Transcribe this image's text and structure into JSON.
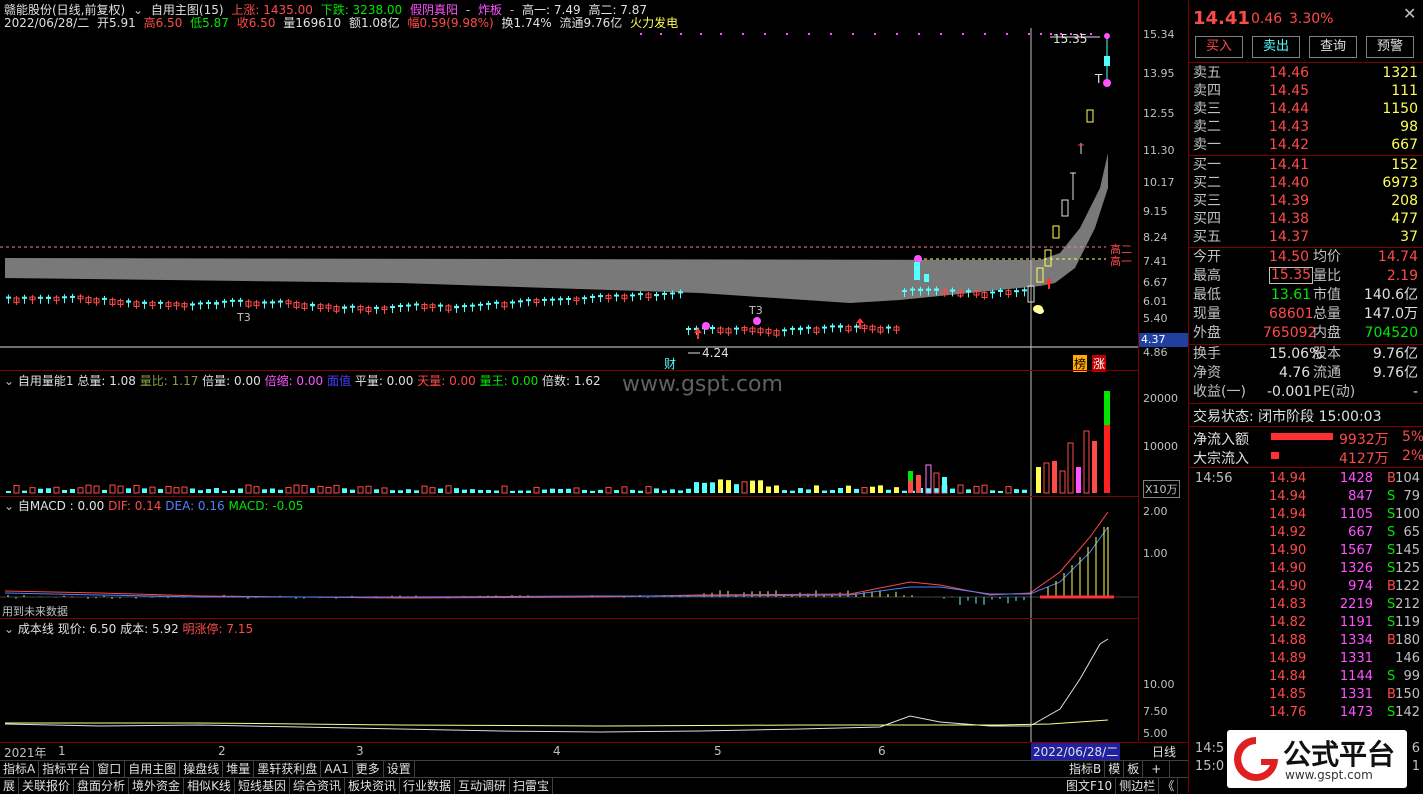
{
  "header": {
    "stock_name": "赣能股份(日线,前复权)",
    "indicator_name": "自用主图(15)",
    "up": "上涨: 1435.00",
    "down": "下跌: 3238.00",
    "yinyang": "假阴真阳",
    "zhaban": "炸板",
    "gao1": "高一: 7.49",
    "gao2": "高二: 7.87",
    "date": "2022/06/28/二",
    "open": "开5.91",
    "high": "高6.50",
    "low": "低5.87",
    "close": "收6.50",
    "volume": "量169610",
    "amount": "额1.08亿",
    "amplitude": "幅0.59(9.98%)",
    "turnover": "换1.74%",
    "float_cap": "流通9.76亿",
    "sector": "火力发电"
  },
  "main_pane": {
    "annot_high": "15.35",
    "annot_low": "4.24",
    "t3_1": "T3",
    "t3_2": "T3",
    "t_label": "T",
    "cai": "财",
    "bang": "榜",
    "zhang": "涨",
    "gao_er": "高二",
    "gao_yi": "高一",
    "current_tag": "4.37"
  },
  "right_axis": {
    "main_ticks": [
      "15.34",
      "13.95",
      "12.55",
      "11.30",
      "10.17",
      "9.15",
      "8.24",
      "7.41",
      "6.67",
      "6.01",
      "5.40",
      "4.86"
    ],
    "vol_ticks": [
      "20000",
      "10000",
      "X10万"
    ],
    "macd_ticks": [
      "2.00",
      "1.00"
    ],
    "cost_ticks": [
      "10.00",
      "7.50",
      "5.00"
    ]
  },
  "vol_pane": {
    "name": "自用量能1",
    "total": "总量: 1.08",
    "ratio": "量比: 1.17",
    "bei": "倍量: 0.00",
    "beisuo": "倍缩: 0.00",
    "mian": "面值",
    "ping": "平量: 0.00",
    "tian": "天量: 0.00",
    "wang": "量王: 0.00",
    "beishu": "倍数: 1.62",
    "watermark": "www.gspt.com"
  },
  "macd_pane": {
    "name": "自MACD : 0.00",
    "dif": "DIF: 0.14",
    "dea": "DEA: 0.16",
    "macd": "MACD: -0.05",
    "future_note": "用到未来数据"
  },
  "cost_pane": {
    "name": "成本线",
    "now": "现价: 6.50",
    "cost": "成本: 5.92",
    "zhangting": "明涨停: 7.15"
  },
  "timebar": {
    "year": "2021年",
    "m1": "1",
    "m2": "2",
    "m3": "3",
    "m4": "4",
    "m5": "5",
    "m6": "6",
    "cursor_date": "2022/06/28/二",
    "period": "日线"
  },
  "tabs_row1": [
    "指标A",
    "指标平台",
    "窗口",
    "自用主图",
    "操盘线",
    "堆量",
    "墨轩获利盘",
    "AA1",
    "更多",
    "设置"
  ],
  "tabs_row1_right": [
    "指标B",
    "模",
    "板",
    "+",
    "-"
  ],
  "tabs_row2": [
    "展",
    "关联报价",
    "盘面分析",
    "境外资金",
    "相似K线",
    "短线基因",
    "综合资讯",
    "板块资讯",
    "行业数据",
    "互动调研",
    "扫雷宝"
  ],
  "tabs_row2_right": [
    "图文F10",
    "侧边栏",
    "《"
  ],
  "quote": {
    "price": "14.41",
    "change": "0.46",
    "pct": "3.30%",
    "buttons": [
      "买入",
      "卖出",
      "查询",
      "预警"
    ],
    "asks": [
      {
        "label": "卖五",
        "price": "14.46",
        "vol": "1321"
      },
      {
        "label": "卖四",
        "price": "14.45",
        "vol": "111"
      },
      {
        "label": "卖三",
        "price": "14.44",
        "vol": "1150"
      },
      {
        "label": "卖二",
        "price": "14.43",
        "vol": "98"
      },
      {
        "label": "卖一",
        "price": "14.42",
        "vol": "667"
      }
    ],
    "bids": [
      {
        "label": "买一",
        "price": "14.41",
        "vol": "152"
      },
      {
        "label": "买二",
        "price": "14.40",
        "vol": "6973"
      },
      {
        "label": "买三",
        "price": "14.39",
        "vol": "208"
      },
      {
        "label": "买四",
        "price": "14.38",
        "vol": "477"
      },
      {
        "label": "买五",
        "price": "14.37",
        "vol": "37"
      }
    ],
    "stats": [
      {
        "l1": "今开",
        "v1": "14.50",
        "l2": "均价",
        "v2": "14.74"
      },
      {
        "l1": "最高",
        "v1": "15.35",
        "l2": "量比",
        "v2": "2.19"
      },
      {
        "l1": "最低",
        "v1": "13.61",
        "l2": "市值",
        "v2": "140.6亿"
      },
      {
        "l1": "现量",
        "v1": "68601",
        "l2": "总量",
        "v2": "147.0万"
      },
      {
        "l1": "外盘",
        "v1": "765092",
        "l2": "内盘",
        "v2": "704520"
      },
      {
        "l1": "换手",
        "v1": "15.06%",
        "l2": "股本",
        "v2": "9.76亿"
      },
      {
        "l1": "净资",
        "v1": "4.76",
        "l2": "流通",
        "v2": "9.76亿"
      },
      {
        "l1": "收益(一)",
        "v1": "-0.001",
        "l2": "PE(动)",
        "v2": "-"
      }
    ],
    "trade_status": "交易状态: 闭市阶段 15:00:03",
    "netflow_label": "净流入额",
    "netflow_val": "9932万",
    "netflow_pct": "5%",
    "bigflow_label": "大宗流入",
    "bigflow_val": "4127万",
    "bigflow_pct": "2%",
    "ticks": [
      {
        "t": "14:56",
        "p": "14.94",
        "v": "1428",
        "s": "B",
        "n": "104"
      },
      {
        "t": "",
        "p": "14.94",
        "v": "847",
        "s": "S",
        "n": "79"
      },
      {
        "t": "",
        "p": "14.94",
        "v": "1105",
        "s": "S",
        "n": "100"
      },
      {
        "t": "",
        "p": "14.92",
        "v": "667",
        "s": "S",
        "n": "65"
      },
      {
        "t": "",
        "p": "14.90",
        "v": "1567",
        "s": "S",
        "n": "145"
      },
      {
        "t": "",
        "p": "14.90",
        "v": "1326",
        "s": "S",
        "n": "125"
      },
      {
        "t": "",
        "p": "14.90",
        "v": "974",
        "s": "B",
        "n": "122"
      },
      {
        "t": "",
        "p": "14.83",
        "v": "2219",
        "s": "S",
        "n": "212"
      },
      {
        "t": "",
        "p": "14.82",
        "v": "1191",
        "s": "S",
        "n": "119"
      },
      {
        "t": "",
        "p": "14.88",
        "v": "1334",
        "s": "B",
        "n": "180"
      },
      {
        "t": "",
        "p": "14.89",
        "v": "1331",
        "s": "",
        "n": "146"
      },
      {
        "t": "",
        "p": "14.84",
        "v": "1144",
        "s": "S",
        "n": "99"
      },
      {
        "t": "",
        "p": "14.85",
        "v": "1331",
        "s": "B",
        "n": "150"
      },
      {
        "t": "",
        "p": "14.76",
        "v": "1473",
        "s": "S",
        "n": "142"
      }
    ],
    "bottom_time1": "14:5",
    "bottom_time2": "15:0",
    "bottom_v1": "6",
    "bottom_v2": "1"
  },
  "logo": {
    "text": "公式平台",
    "url": "www.gspt.com"
  },
  "colors": {
    "up": "#ff4a4a",
    "down": "#54ffff",
    "bg": "#000000",
    "grid": "#800000"
  }
}
